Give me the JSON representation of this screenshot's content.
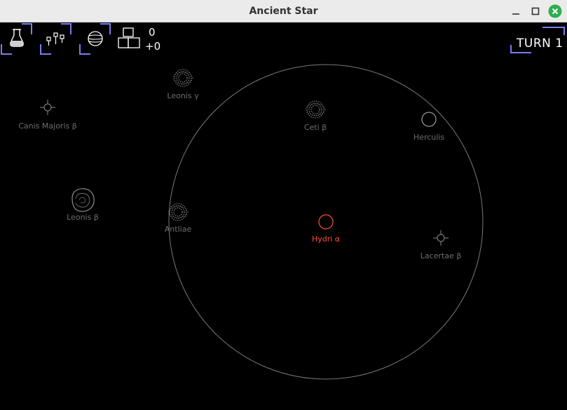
{
  "window": {
    "title": "Ancient Star",
    "controls": [
      "minimize",
      "maximize",
      "close"
    ]
  },
  "hud": {
    "buttons": [
      {
        "name": "research-button",
        "icon": "flask-icon"
      },
      {
        "name": "fleet-button",
        "icon": "ships-icon"
      },
      {
        "name": "planet-button",
        "icon": "planet-icon"
      }
    ],
    "resource": {
      "icon": "production-icon",
      "value": "0",
      "delta": "+0"
    },
    "turn": {
      "label": "TURN 1"
    }
  },
  "map": {
    "range_circle": "hydri-alpha-range",
    "stars": [
      {
        "name": "Leonis γ",
        "type": "dyson"
      },
      {
        "name": "Canis Majoris β",
        "type": "sparkle"
      },
      {
        "name": "Ceti β",
        "type": "dyson"
      },
      {
        "name": "Herculis",
        "type": "ring"
      },
      {
        "name": "Leonis β",
        "type": "nebula"
      },
      {
        "name": "Antliae",
        "type": "dyson"
      },
      {
        "name": "Hydri α",
        "type": "home"
      },
      {
        "name": "Lacertae β",
        "type": "sparkle"
      }
    ]
  },
  "colors": {
    "background": "#000000",
    "accent": "#7b7bf0",
    "label": "#6e6e6e",
    "home": "#ff4a4a",
    "close": "#2fae4f"
  }
}
